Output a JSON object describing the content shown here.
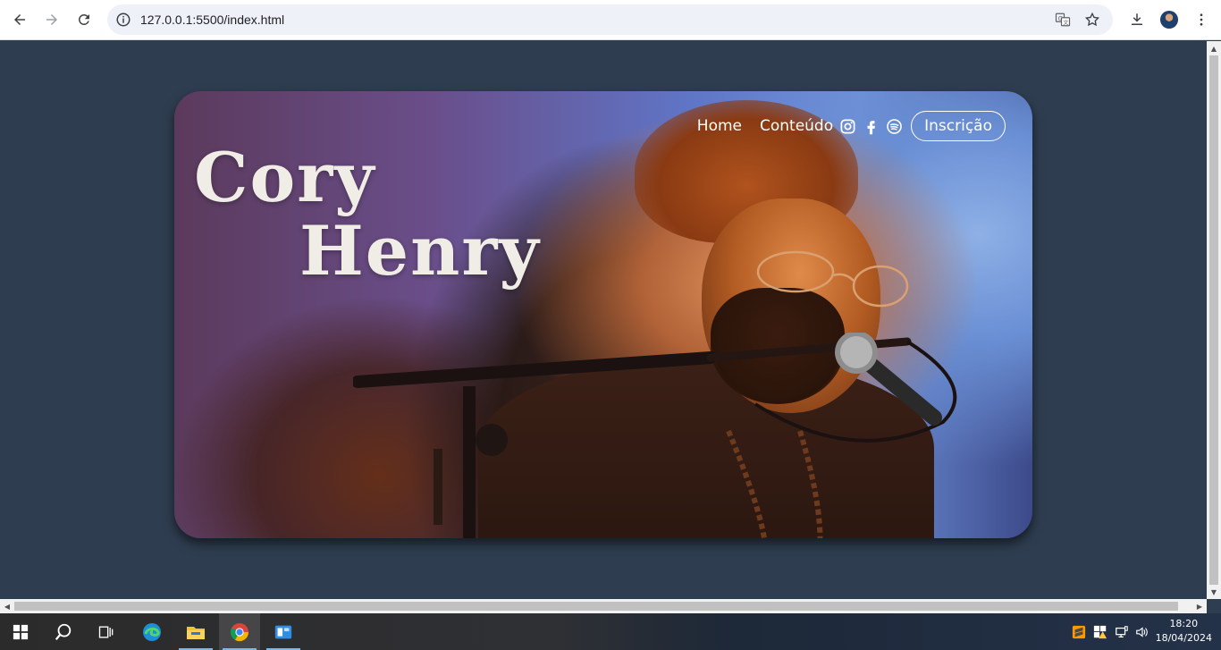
{
  "browser": {
    "url": "127.0.0.1:5500/index.html",
    "nav_icons": [
      "back-arrow-icon",
      "forward-arrow-icon",
      "reload-icon"
    ],
    "omnibox_icons": [
      "site-info-icon",
      "translate-icon",
      "bookmark-star-icon"
    ],
    "toolbar_icons": [
      "download-icon",
      "profile-avatar",
      "kebab-menu-icon"
    ]
  },
  "page": {
    "title_line1": "Cory",
    "title_line2": "Henry",
    "nav": {
      "home": "Home",
      "content": "Conteúdo",
      "social_icons": [
        "instagram-icon",
        "facebook-icon",
        "spotify-icon"
      ],
      "signup": "Inscrição"
    },
    "background_color": "#2e3d50"
  },
  "taskbar": {
    "apps": [
      "windows-start-icon",
      "search-icon",
      "task-view-icon",
      "edge-icon",
      "file-explorer-icon",
      "chrome-icon",
      "vscode-icon"
    ],
    "tray_icons": [
      "sublime-icon",
      "security-warning-icon",
      "network-icon",
      "volume-icon"
    ],
    "time": "18:20",
    "date": "18/04/2024"
  }
}
